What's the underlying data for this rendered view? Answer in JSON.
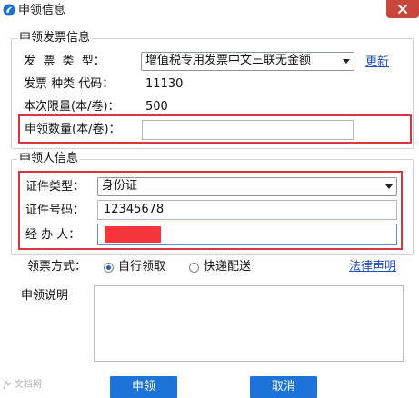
{
  "window": {
    "title": "申领信息",
    "close_icon": "close-icon"
  },
  "invoice_group": {
    "label": "申领发票信息",
    "type_label": "发  票  类  型：",
    "type_value": "增值税专用发票中文三联无金额",
    "update_link": "更新",
    "code_label": "发票 种类 代码：",
    "code_value": "11130",
    "limit_label": "本次限量(本/卷)：",
    "limit_value": "500",
    "quantity_label": "申领数量(本/卷)：",
    "quantity_value": ""
  },
  "applicant_group": {
    "label": "申领人信息",
    "id_type_label": "证件类型：",
    "id_type_value": "身份证",
    "id_number_label": "证件号码：",
    "id_number_value": "12345678",
    "agent_label": "经 办 人：",
    "agent_value": ""
  },
  "delivery": {
    "label": "领票方式：",
    "options": [
      "自行领取",
      "快递配送"
    ],
    "selected": "自行领取",
    "legal_link": "法律声明"
  },
  "remarks": {
    "label": "申领说明",
    "value": ""
  },
  "buttons": {
    "apply": "申领",
    "cancel": "取消"
  },
  "watermark": "文档网",
  "colors": {
    "accent": "#1e73d8",
    "highlight": "#d9363e",
    "redaction": "#f5353b",
    "link": "#1f4fb5"
  }
}
